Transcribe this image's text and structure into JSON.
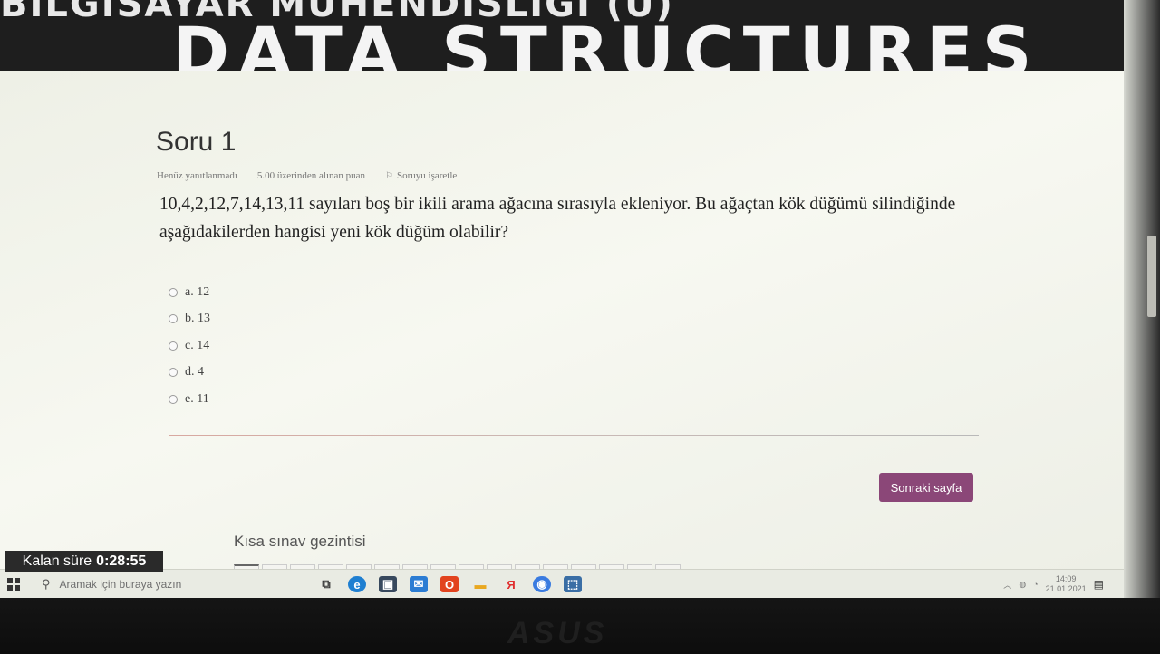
{
  "banner": {
    "line1": "BİLGİSAYAR MÜHENDİSLİĞİ (Ü)",
    "line2": "DATA STRUCTURES"
  },
  "question": {
    "title": "Soru 1",
    "status": "Henüz yanıtlanmadı",
    "points": "5.00 üzerinden alınan puan",
    "flag_label": "Soruyu işaretle",
    "text": "10,4,2,12,7,14,13,11 sayıları boş bir ikili arama ağacına sırasıyla ekleniyor. Bu ağaçtan kök düğümü silindiğinde aşağıdakilerden hangisi yeni kök düğüm olabilir?",
    "options": [
      {
        "label": "a. 12"
      },
      {
        "label": "b. 13"
      },
      {
        "label": "c. 14"
      },
      {
        "label": "d. 4"
      },
      {
        "label": "e. 11"
      }
    ]
  },
  "next_button": "Sonraki sayfa",
  "quiz_nav": {
    "title": "Kısa sınav gezintisi"
  },
  "timer": {
    "label": "Kalan süre",
    "value": "0:28:55"
  },
  "taskbar": {
    "search_placeholder": "Aramak için buraya yazın",
    "clock_time": "14:09",
    "clock_date": "21.01.2021"
  },
  "laptop_brand": "ASUS"
}
